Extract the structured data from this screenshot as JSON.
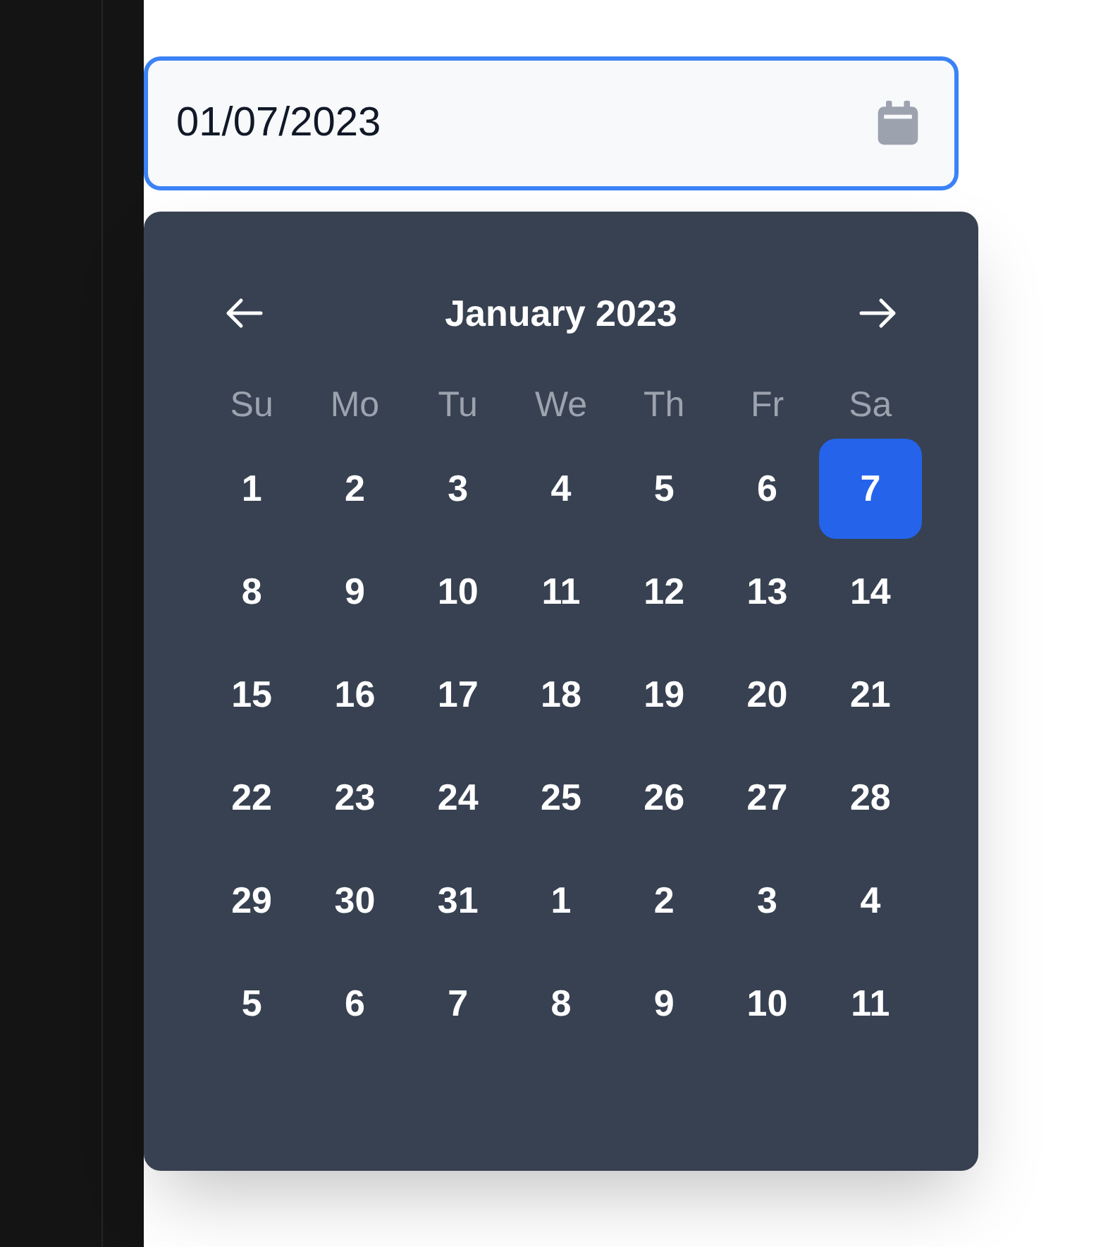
{
  "date_field": {
    "value": "01/07/2023"
  },
  "calendar": {
    "month_label": "January 2023",
    "weekdays": [
      "Su",
      "Mo",
      "Tu",
      "We",
      "Th",
      "Fr",
      "Sa"
    ],
    "days": [
      {
        "label": "1",
        "selected": false
      },
      {
        "label": "2",
        "selected": false
      },
      {
        "label": "3",
        "selected": false
      },
      {
        "label": "4",
        "selected": false
      },
      {
        "label": "5",
        "selected": false
      },
      {
        "label": "6",
        "selected": false
      },
      {
        "label": "7",
        "selected": true
      },
      {
        "label": "8",
        "selected": false
      },
      {
        "label": "9",
        "selected": false
      },
      {
        "label": "10",
        "selected": false
      },
      {
        "label": "11",
        "selected": false
      },
      {
        "label": "12",
        "selected": false
      },
      {
        "label": "13",
        "selected": false
      },
      {
        "label": "14",
        "selected": false
      },
      {
        "label": "15",
        "selected": false
      },
      {
        "label": "16",
        "selected": false
      },
      {
        "label": "17",
        "selected": false
      },
      {
        "label": "18",
        "selected": false
      },
      {
        "label": "19",
        "selected": false
      },
      {
        "label": "20",
        "selected": false
      },
      {
        "label": "21",
        "selected": false
      },
      {
        "label": "22",
        "selected": false
      },
      {
        "label": "23",
        "selected": false
      },
      {
        "label": "24",
        "selected": false
      },
      {
        "label": "25",
        "selected": false
      },
      {
        "label": "26",
        "selected": false
      },
      {
        "label": "27",
        "selected": false
      },
      {
        "label": "28",
        "selected": false
      },
      {
        "label": "29",
        "selected": false
      },
      {
        "label": "30",
        "selected": false
      },
      {
        "label": "31",
        "selected": false
      },
      {
        "label": "1",
        "selected": false
      },
      {
        "label": "2",
        "selected": false
      },
      {
        "label": "3",
        "selected": false
      },
      {
        "label": "4",
        "selected": false
      },
      {
        "label": "5",
        "selected": false
      },
      {
        "label": "6",
        "selected": false
      },
      {
        "label": "7",
        "selected": false
      },
      {
        "label": "8",
        "selected": false
      },
      {
        "label": "9",
        "selected": false
      },
      {
        "label": "10",
        "selected": false
      },
      {
        "label": "11",
        "selected": false
      }
    ]
  }
}
